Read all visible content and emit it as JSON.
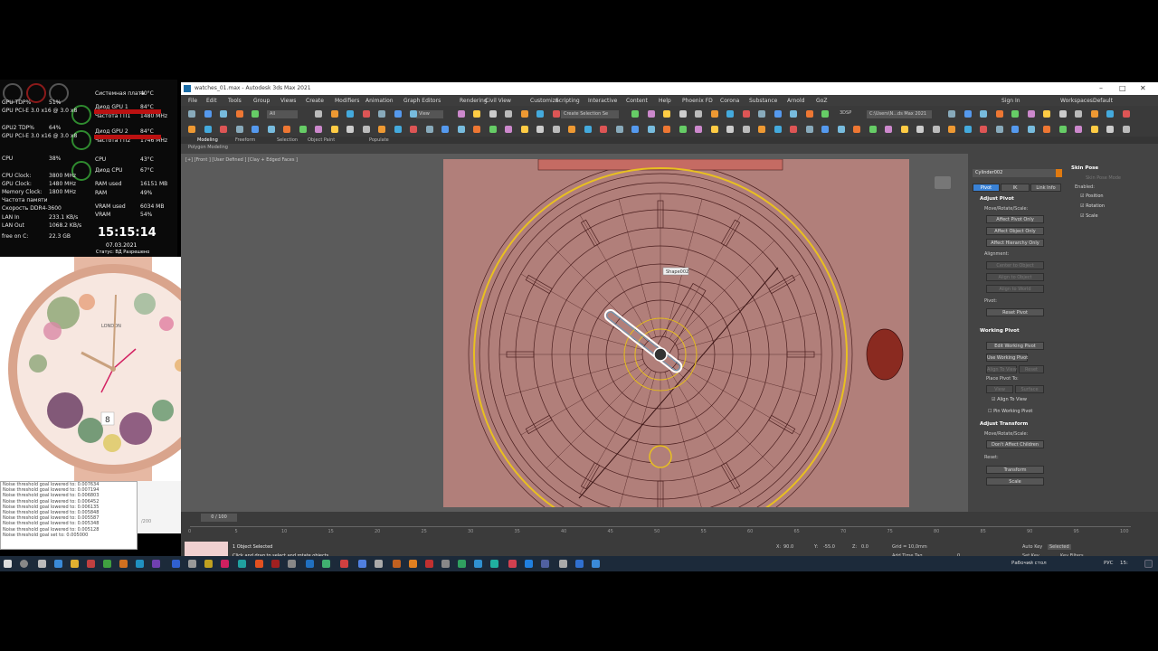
{
  "hwmonitor": {
    "rows_left": [
      {
        "label": "GPU TDP%",
        "value": "51%"
      },
      {
        "label": "GPU PCI-E 3.0 x16 @ 3.0 x8",
        "value": ""
      },
      {
        "label": "GPU2 TDP%",
        "value": "64%"
      },
      {
        "label": "GPU PCI-E 3.0 x16 @ 3.0 x8",
        "value": ""
      },
      {
        "label": "CPU",
        "value": "38%"
      },
      {
        "label": "CPU Clock:",
        "value": "3800 MHz"
      },
      {
        "label": "GPU Clock:",
        "value": "1480 MHz"
      },
      {
        "label": "Memory Clock:",
        "value": "1800 MHz"
      },
      {
        "label": "Частота памяти",
        "value": ""
      },
      {
        "label": "Скорость  DDR4-3600",
        "value": ""
      },
      {
        "label": "LAN In",
        "value": "233.1 KB/s"
      },
      {
        "label": "LAN Out",
        "value": "1068.2 KB/s"
      },
      {
        "label": "free on C:",
        "value": "22.3 GB"
      }
    ],
    "rows_right": [
      {
        "label": "Системная плата",
        "value": "40°C"
      },
      {
        "label": "Диод GPU 1",
        "value": "84°C"
      },
      {
        "label": "Частота ГП1",
        "value": "1480 MHz"
      },
      {
        "label": "Диод GPU 2",
        "value": "84°C"
      },
      {
        "label": "Частота ГП2",
        "value": "1746 MHz"
      },
      {
        "label": "CPU",
        "value": "43°C"
      },
      {
        "label": "Диод CPU",
        "value": "67°C"
      },
      {
        "label": "RAM used",
        "value": "16151 MB"
      },
      {
        "label": "RAM",
        "value": "49%"
      },
      {
        "label": "VRAM used",
        "value": "6034 MB"
      },
      {
        "label": "VRAM",
        "value": "54%"
      }
    ],
    "clock": "15:15:14",
    "date": "07.03.2021",
    "status": "Статус: ВД Разрешено"
  },
  "photo": {
    "brand": "LONDON",
    "date_window": "8"
  },
  "log": {
    "lines": [
      "Noise threshold goal lowered to: 0.007634",
      "Noise threshold goal lowered to: 0.007194",
      "Noise threshold goal lowered to: 0.006803",
      "Noise threshold goal lowered to: 0.006452",
      "Noise threshold goal lowered to: 0.006135",
      "Noise threshold goal lowered to: 0.005848",
      "Noise threshold goal lowered to: 0.005587",
      "Noise threshold goal lowered to: 0.005348",
      "Noise threshold goal lowered to: 0.005128",
      "Noise threshold goal set to: 0.005000"
    ],
    "side_text": "/200"
  },
  "app": {
    "title": "watches_01.max - Autodesk 3ds Max 2021",
    "menus": [
      "File",
      "Edit",
      "Tools",
      "Group",
      "Views",
      "Create",
      "Modifiers",
      "Animation",
      "Graph Editors",
      "Rendering",
      "Civil View",
      "Customize",
      "Scripting",
      "Interactive",
      "Content",
      "Help",
      "Phoenix FD",
      "Corona",
      "Substance",
      "Arnold",
      "GoZ"
    ],
    "sign_in": "Sign In",
    "workspaces_label": "Workspaces:",
    "workspaces_value": "Default",
    "selection_filter": "All",
    "view_dropdown": "View",
    "selection_set": "Create Selection Se",
    "path": "C:\\Users\\N...ds Max 2021",
    "snap": "3DSP",
    "ribbon_tabs": [
      "Modeling",
      "Freeform",
      "Selection",
      "Object Paint",
      "Populate"
    ],
    "ribbon_sub": "Polygon Modeling",
    "viewport_label": "[+] [Front ] [User Defined ] [Clay + Edged Faces ]",
    "viewport_tooltip": "Shape002"
  },
  "command_panel": {
    "object_name": "Cylinder002",
    "tabs": [
      "Pivot",
      "IK",
      "Link Info"
    ],
    "adjust_pivot": {
      "title": "Adjust Pivot",
      "move_label": "Move/Rotate/Scale:",
      "buttons": [
        "Affect Pivot Only",
        "Affect Object Only",
        "Affect Hierarchy Only"
      ],
      "alignment_label": "Alignment:",
      "align_buttons": [
        "Center to Object",
        "Align to Object",
        "Align to World"
      ],
      "pivot_label": "Pivot:",
      "reset_button": "Reset Pivot"
    },
    "working_pivot": {
      "title": "Working Pivot",
      "edit_button": "Edit Working Pivot",
      "use_button": "Use Working Pivot",
      "align_view": "Align To View",
      "reset": "Reset",
      "place_label": "Place Pivot To:",
      "place_view": "View",
      "place_surface": "Surface",
      "align_check": "Align To View",
      "pin_check": "Pin Working Pivot"
    },
    "adjust_transform": {
      "title": "Adjust Transform",
      "move_label": "Move/Rotate/Scale:",
      "dont_affect": "Don't Affect Children",
      "reset_label": "Reset:",
      "transform": "Transform",
      "scale": "Scale"
    },
    "skin_pose": {
      "title": "Skin Pose",
      "from_mode": "Skin Pose Mode",
      "enabled_label": "Enabled:",
      "position": "Position",
      "rotation": "Rotation",
      "scale": "Scale"
    }
  },
  "timeline": {
    "frame_label": "0 / 100",
    "ticks": [
      "0",
      "5",
      "10",
      "15",
      "20",
      "25",
      "30",
      "35",
      "40",
      "45",
      "50",
      "55",
      "60",
      "65",
      "70",
      "75",
      "80",
      "85",
      "90",
      "95",
      "100"
    ]
  },
  "status": {
    "selected": "1 Object Selected",
    "hint": "Click and drag to select and rotate objects",
    "x_label": "X:",
    "x_value": "90.0",
    "y_label": "Y:",
    "y_value": "-55.0",
    "z_label": "Z:",
    "z_value": "0.0",
    "grid": "Grid = 10,0mm",
    "add_time_tag": "Add Time Tag",
    "auto_key": "Auto Key",
    "set_key": "Set Key",
    "selected_dd": "Selected",
    "key_filters": "Key Filters...",
    "frame_value": "0"
  },
  "taskbar": {
    "desktop": "Рабочий стол",
    "lang": "РУС",
    "time": "15:"
  },
  "colors": {
    "viewport": "#b17f7a",
    "wire": "#4a1e1e",
    "selection": "#e8c020",
    "accent": "#3a82d6"
  }
}
